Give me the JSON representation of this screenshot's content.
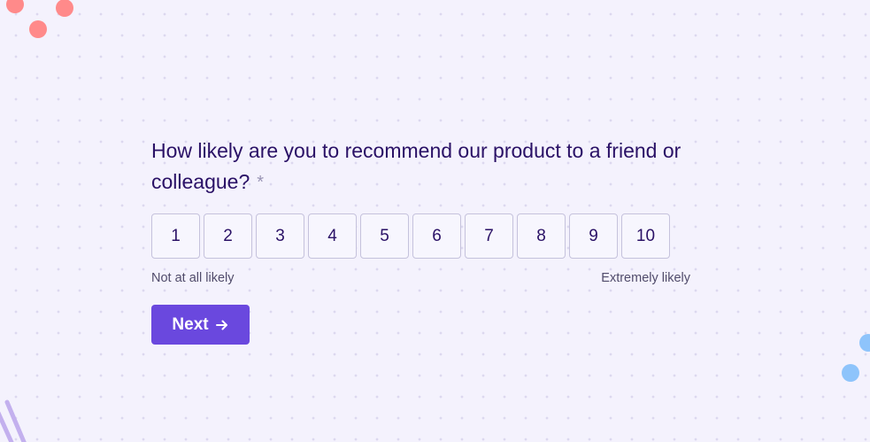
{
  "survey": {
    "question": "How likely are you to recommend our product to a friend or colleague?",
    "required_mark": "*",
    "scale": [
      "1",
      "2",
      "3",
      "4",
      "5",
      "6",
      "7",
      "8",
      "9",
      "10"
    ],
    "low_label": "Not at all likely",
    "high_label": "Extremely likely",
    "next_label": "Next"
  },
  "colors": {
    "background": "#f4f2fd",
    "primary": "#6a48de",
    "text": "#2a1166",
    "decor_red": "#ff8a8a",
    "decor_blue": "#8ec4fb",
    "decor_lines": "#c3b0ee"
  },
  "icons": {
    "next": "arrow-right-icon"
  }
}
